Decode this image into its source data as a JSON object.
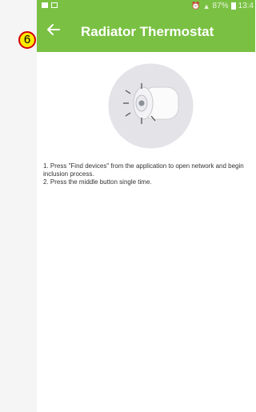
{
  "status_bar": {
    "right_text": "87%",
    "time": "13:4"
  },
  "app_bar": {
    "title": "Radiator Thermostat",
    "back_icon": "arrow-left-icon",
    "background": "#7ac143"
  },
  "annotation": {
    "step_number": "6"
  },
  "device": {
    "image_icon": "radiator-thermostat-image"
  },
  "instructions": {
    "line1": "1. Press \"Find devices\" from the application to open network and begin inclusion process.",
    "line2": "2. Press the middle button single time."
  }
}
